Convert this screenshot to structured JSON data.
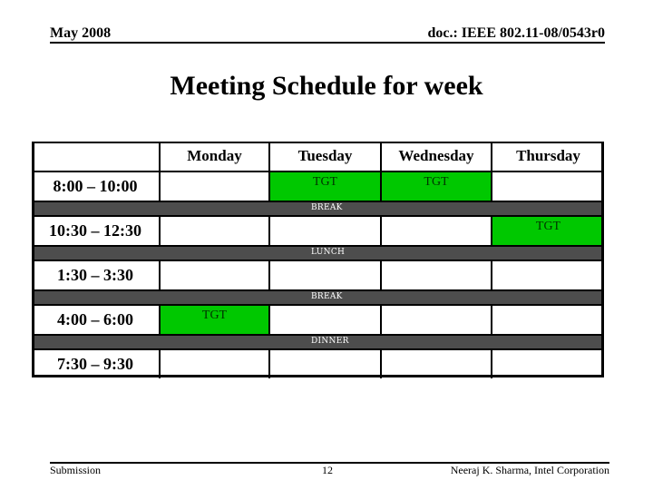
{
  "header": {
    "date": "May 2008",
    "doc_id": "doc.: IEEE 802.11-08/0543r0"
  },
  "title": "Meeting Schedule for week",
  "schedule": {
    "days": [
      "Monday",
      "Tuesday",
      "Wednesday",
      "Thursday"
    ],
    "slots": [
      {
        "time": "8:00 – 10:00",
        "cells": [
          "",
          "TGT",
          "TGT",
          ""
        ]
      },
      {
        "time": "10:30 – 12:30",
        "cells": [
          "",
          "",
          "",
          "TGT"
        ]
      },
      {
        "time": "1:30 – 3:30",
        "cells": [
          "",
          "",
          "",
          ""
        ]
      },
      {
        "time": "4:00 – 6:00",
        "cells": [
          "TGT",
          "",
          "",
          ""
        ]
      },
      {
        "time": "7:30 – 9:30",
        "cells": [
          "",
          "",
          "",
          ""
        ]
      }
    ],
    "breaks": [
      "BREAK",
      "LUNCH",
      "BREAK",
      "DINNER"
    ],
    "colors": {
      "session": "#00c800",
      "break_band": "#4d4d4d"
    }
  },
  "footer": {
    "left": "Submission",
    "page": "12",
    "author": "Neeraj K. Sharma, Intel Corporation"
  }
}
